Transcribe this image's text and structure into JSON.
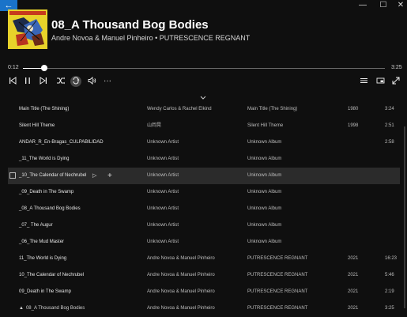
{
  "window": {
    "back_icon": "←",
    "minimize_icon": "—",
    "maximize_icon": "☐",
    "close_icon": "✕"
  },
  "now_playing": {
    "album_art_text": "Putrescence Regnant",
    "title": "08_A Thousand Bog Bodies",
    "subtitle": "Andre Novoa & Manuel Pinheiro • PUTRESCENCE REGNANT"
  },
  "progress": {
    "elapsed": "0:12",
    "total": "3:25",
    "fraction": 0.06
  },
  "controls": {
    "prev": "previous-icon",
    "pause": "pause-icon",
    "next": "next-icon",
    "shuffle": "shuffle-icon",
    "repeat": "repeat-icon",
    "volume": "volume-icon",
    "more": "···"
  },
  "right_controls": [
    "queue-icon",
    "miniplayer-icon",
    "fullscreen-icon"
  ],
  "tracks": [
    {
      "title": "Main Title (The Shining)",
      "artist": "Wendy Carlos & Rachel Elkind",
      "album": "Main Title (The Shining)",
      "year": "1980",
      "duration": "3:24"
    },
    {
      "title": "Silent Hill Theme",
      "artist": "山岡晃",
      "album": "Silent Hill Theme",
      "year": "1998",
      "duration": "2:51"
    },
    {
      "title": "ANDAR_R_En-Bragas_CULPABILIDAD",
      "artist": "Unknown Artist",
      "album": "Unknown Album",
      "year": "",
      "duration": "2:58"
    },
    {
      "title": "_11_The World is Dying",
      "artist": "Unknown Artist",
      "album": "Unknown Album",
      "year": "",
      "duration": ""
    },
    {
      "title": "_10_The Calendar of Nechrubel",
      "artist": "Unknown Artist",
      "album": "Unknown Album",
      "year": "",
      "duration": ""
    },
    {
      "title": "_09_Death in The Swamp",
      "artist": "Unknown Artist",
      "album": "Unknown Album",
      "year": "",
      "duration": ""
    },
    {
      "title": "_08_A Thousand Bog Bodies",
      "artist": "Unknown Artist",
      "album": "Unknown Album",
      "year": "",
      "duration": ""
    },
    {
      "title": "_07_ The Augur",
      "artist": "Unknown Artist",
      "album": "Unknown Album",
      "year": "",
      "duration": ""
    },
    {
      "title": "_06_The Mud Master",
      "artist": "Unknown Artist",
      "album": "Unknown Album",
      "year": "",
      "duration": ""
    },
    {
      "title": "11_The World is Dying",
      "artist": "Andre Novoa & Manuel Pinheiro",
      "album": "PUTRESCENCE REGNANT",
      "year": "2021",
      "duration": "16:23"
    },
    {
      "title": "10_The Calendar of Nechrubel",
      "artist": "Andre Novoa & Manuel Pinheiro",
      "album": "PUTRESCENCE REGNANT",
      "year": "2021",
      "duration": "5:46"
    },
    {
      "title": "09_Death in The Swamp",
      "artist": "Andre Novoa & Manuel Pinheiro",
      "album": "PUTRESCENCE REGNANT",
      "year": "2021",
      "duration": "2:19"
    },
    {
      "title": "08_A Thousand Bog Bodies",
      "artist": "Andre Novoa & Manuel Pinheiro",
      "album": "PUTRESCENCE REGNANT",
      "year": "2021",
      "duration": "3:25"
    }
  ],
  "hover_row_index": 4,
  "playing_row_index": 12,
  "colors": {
    "accent": "#1a73c9",
    "background": "#0f0f0f",
    "hover_row": "#2b2b2b"
  }
}
